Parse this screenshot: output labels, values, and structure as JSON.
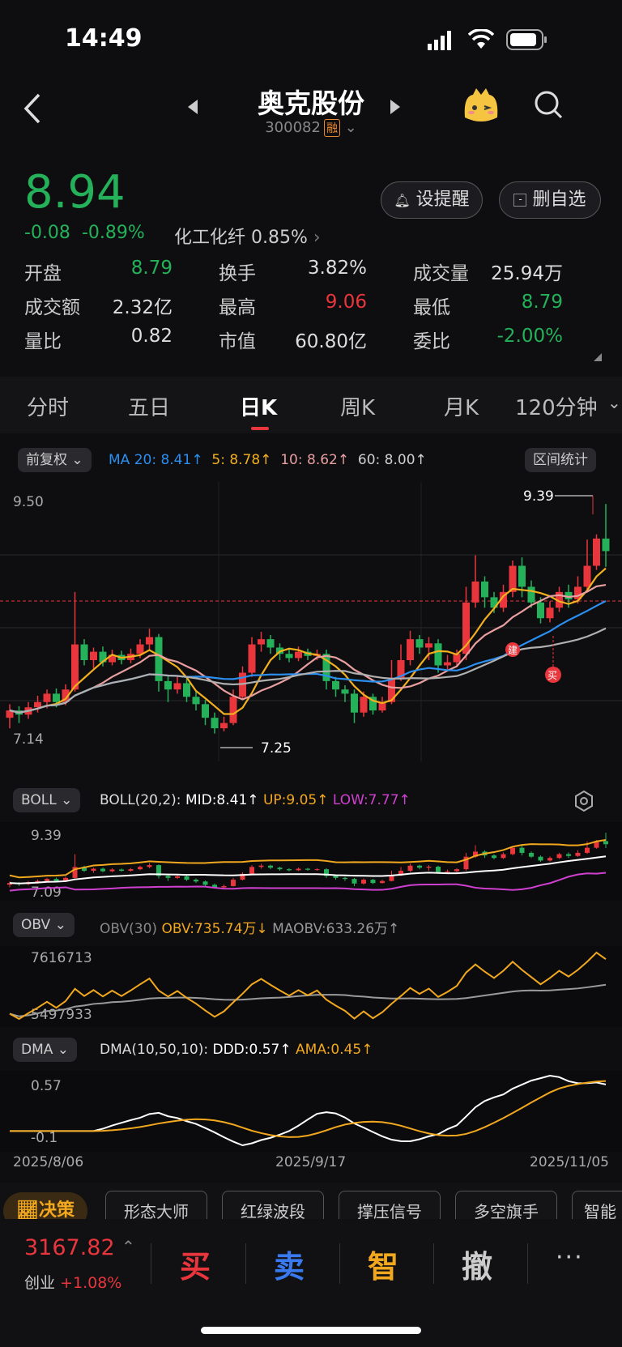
{
  "status_bar": {
    "time": "14:49"
  },
  "header": {
    "title": "奥克股份",
    "code": "300082",
    "margin_tag": "融"
  },
  "quote": {
    "price": "8.94",
    "change": "-0.08",
    "change_pct": "-0.89%",
    "sector": "化工化纤 0.85%",
    "alert_label": "设提醒",
    "watchlist_label": "删自选",
    "stats": [
      [
        {
          "label": "开盘",
          "value": "8.79",
          "color": "green"
        },
        {
          "label": "换手",
          "value": "3.82%",
          "color": ""
        },
        {
          "label": "成交量",
          "value": "25.94万",
          "color": ""
        }
      ],
      [
        {
          "label": "成交额",
          "value": "2.32亿",
          "color": ""
        },
        {
          "label": "最高",
          "value": "9.06",
          "color": "red"
        },
        {
          "label": "最低",
          "value": "8.79",
          "color": "green"
        }
      ],
      [
        {
          "label": "量比",
          "value": "0.82",
          "color": ""
        },
        {
          "label": "市值",
          "value": "60.80亿",
          "color": ""
        },
        {
          "label": "委比",
          "value": "-2.00%",
          "color": "green"
        }
      ]
    ]
  },
  "tabs": [
    "分时",
    "五日",
    "日K",
    "周K",
    "月K",
    "120分钟"
  ],
  "active_tab": "日K",
  "kline_legend": {
    "adjust": "前复权",
    "ma20": "MA 20: 8.41↑",
    "ma5": "5: 8.78↑",
    "ma10": "10: 8.62↑",
    "ma60": "60: 8.00↑",
    "range_stats": "区间统计"
  },
  "kline_axis": {
    "top": "9.50",
    "bottom": "7.14",
    "high_label": "9.39",
    "low_label": "7.25",
    "buy_tag": "买",
    "build_tag": "建"
  },
  "boll": {
    "name": "BOLL",
    "params": "BOLL(20,2):",
    "mid": "MID:8.41↑",
    "up": "UP:9.05↑",
    "low": "LOW:7.77↑",
    "top_val": "9.39",
    "bottom_val": "7.09"
  },
  "obv": {
    "name": "OBV",
    "params": "OBV(30)",
    "obv": "OBV:735.74万↓",
    "maobv": "MAOBV:633.26万↑",
    "top_val": "7616713",
    "bottom_val": "5497933"
  },
  "dma": {
    "name": "DMA",
    "params": "DMA(10,50,10):",
    "ddd": "DDD:0.57↑",
    "ama": "AMA:0.45↑",
    "top_val": "0.57",
    "bottom_val": "-0.1"
  },
  "dates": [
    "2025/8/06",
    "2025/9/17",
    "2025/11/05"
  ],
  "toolbar": [
    "决策",
    "形态大师",
    "红绿波段",
    "撑压信号",
    "多空旗手",
    "智能"
  ],
  "bottom_bar": {
    "index_value": "3167.82",
    "index_name": "创业",
    "index_change": "+1.08%",
    "buy": "买",
    "sell": "卖",
    "smart": "智",
    "cancel": "撤",
    "more": "···"
  },
  "colors": {
    "up": "#e8363c",
    "down": "#25b15a",
    "ma5": "#f2b01e",
    "ma10": "#e89fa0",
    "ma20": "#2b8ff0",
    "ma60": "#b0b0b0",
    "boll_mid": "#ffffff",
    "boll_up": "#f2a81e",
    "boll_low": "#d040d0"
  },
  "chart_data": {
    "type": "candlestick",
    "x_range": [
      "2025/8/06",
      "2025/11/05"
    ],
    "ylim": [
      7.14,
      9.5
    ],
    "max_label": 9.39,
    "min_label": 7.25,
    "ma_last": {
      "ma5": 8.78,
      "ma10": 8.62,
      "ma20": 8.41,
      "ma60": 8.0
    },
    "candles": [
      [
        7.35,
        7.42,
        7.25,
        7.48
      ],
      [
        7.42,
        7.38,
        7.3,
        7.46
      ],
      [
        7.38,
        7.45,
        7.34,
        7.5
      ],
      [
        7.45,
        7.5,
        7.4,
        7.56
      ],
      [
        7.5,
        7.58,
        7.44,
        7.62
      ],
      [
        7.58,
        7.5,
        7.45,
        7.63
      ],
      [
        7.5,
        7.62,
        7.47,
        7.67
      ],
      [
        7.62,
        8.05,
        7.6,
        8.55
      ],
      [
        8.05,
        7.9,
        7.85,
        8.1
      ],
      [
        7.9,
        7.98,
        7.82,
        8.02
      ],
      [
        7.98,
        7.88,
        7.84,
        8.03
      ],
      [
        7.88,
        7.95,
        7.85,
        8.0
      ],
      [
        7.95,
        7.9,
        7.86,
        7.99
      ],
      [
        7.9,
        7.96,
        7.87,
        8.01
      ],
      [
        7.96,
        8.05,
        7.92,
        8.1
      ],
      [
        8.05,
        8.12,
        8.0,
        8.2
      ],
      [
        8.12,
        7.7,
        7.6,
        8.15
      ],
      [
        7.7,
        7.62,
        7.5,
        7.76
      ],
      [
        7.62,
        7.68,
        7.58,
        7.75
      ],
      [
        7.68,
        7.55,
        7.5,
        7.72
      ],
      [
        7.55,
        7.48,
        7.42,
        7.6
      ],
      [
        7.48,
        7.35,
        7.28,
        7.52
      ],
      [
        7.35,
        7.25,
        7.2,
        7.4
      ],
      [
        7.25,
        7.3,
        7.22,
        7.36
      ],
      [
        7.3,
        7.55,
        7.28,
        7.62
      ],
      [
        7.55,
        7.78,
        7.52,
        7.84
      ],
      [
        7.78,
        8.05,
        7.74,
        8.12
      ],
      [
        8.05,
        8.1,
        7.98,
        8.17
      ],
      [
        8.1,
        8.02,
        7.96,
        8.14
      ],
      [
        8.02,
        7.96,
        7.9,
        8.06
      ],
      [
        7.96,
        7.92,
        7.88,
        8.0
      ],
      [
        7.92,
        7.98,
        7.89,
        8.03
      ],
      [
        7.98,
        7.94,
        7.9,
        8.01
      ],
      [
        7.94,
        7.96,
        7.9,
        8.0
      ],
      [
        7.96,
        7.7,
        7.62,
        8.0
      ],
      [
        7.7,
        7.62,
        7.55,
        7.74
      ],
      [
        7.62,
        7.58,
        7.5,
        7.66
      ],
      [
        7.58,
        7.4,
        7.3,
        7.62
      ],
      [
        7.4,
        7.55,
        7.36,
        7.6
      ],
      [
        7.55,
        7.42,
        7.38,
        7.58
      ],
      [
        7.42,
        7.5,
        7.4,
        7.55
      ],
      [
        7.5,
        7.72,
        7.48,
        7.9
      ],
      [
        7.72,
        7.9,
        7.7,
        8.05
      ],
      [
        7.9,
        8.1,
        7.85,
        8.18
      ],
      [
        8.1,
        8.02,
        7.96,
        8.14
      ],
      [
        8.02,
        8.06,
        7.9,
        8.12
      ],
      [
        8.06,
        7.85,
        7.78,
        8.1
      ],
      [
        7.85,
        7.88,
        7.8,
        7.95
      ],
      [
        7.88,
        7.96,
        7.84,
        8.0
      ],
      [
        7.96,
        8.45,
        7.9,
        8.6
      ],
      [
        8.45,
        8.65,
        8.4,
        8.9
      ],
      [
        8.65,
        8.5,
        8.4,
        8.7
      ],
      [
        8.5,
        8.4,
        8.35,
        8.55
      ],
      [
        8.4,
        8.55,
        8.36,
        8.62
      ],
      [
        8.55,
        8.8,
        8.5,
        8.85
      ],
      [
        8.8,
        8.6,
        8.5,
        8.88
      ],
      [
        8.6,
        8.45,
        8.4,
        8.66
      ],
      [
        8.45,
        8.3,
        8.25,
        8.5
      ],
      [
        8.3,
        8.4,
        8.26,
        8.46
      ],
      [
        8.4,
        8.55,
        8.36,
        8.6
      ],
      [
        8.55,
        8.48,
        8.4,
        8.62
      ],
      [
        8.48,
        8.6,
        8.44,
        8.7
      ],
      [
        8.6,
        8.8,
        8.56,
        9.05
      ],
      [
        8.8,
        9.06,
        8.76,
        9.1
      ],
      [
        9.06,
        8.94,
        8.79,
        9.39
      ]
    ]
  }
}
